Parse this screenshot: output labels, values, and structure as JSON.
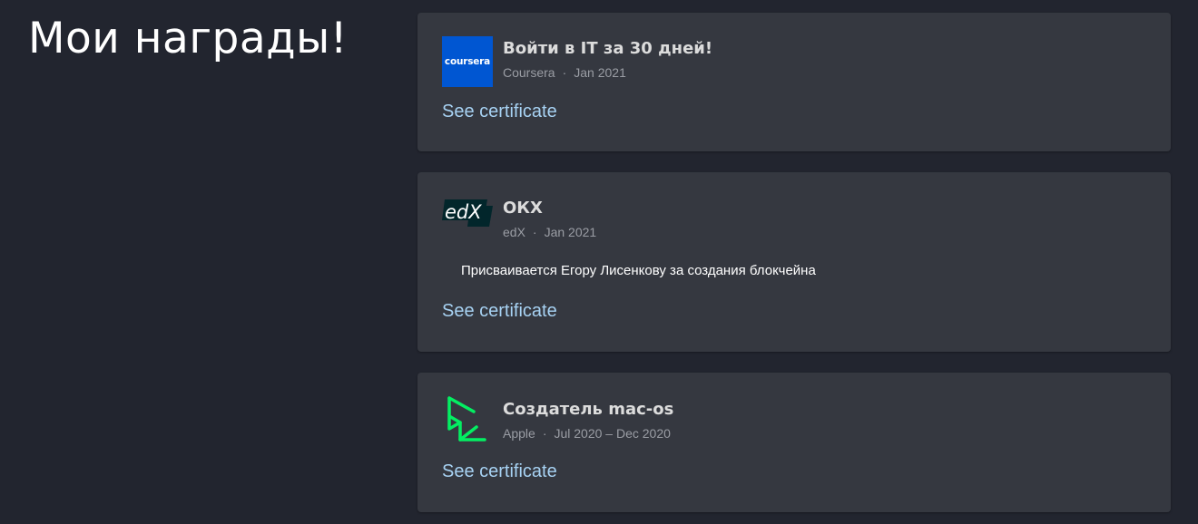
{
  "page": {
    "title": "Мои награды!"
  },
  "certificates": [
    {
      "title": "Войти в IT за 30 дней!",
      "issuer": "Coursera",
      "separator": "·",
      "date": "Jan 2021",
      "logo_text": "coursera",
      "logo_icon": "coursera-logo",
      "link_label": "See certificate"
    },
    {
      "title": "ОКХ",
      "issuer": "edX",
      "separator": "·",
      "date": "Jan 2021",
      "description": "Присваивается Егору Лисенкову за создания блокчейна",
      "logo_text": "edX",
      "logo_icon": "edx-logo",
      "link_label": "See certificate"
    },
    {
      "title": "Создатель mac-os",
      "issuer": "Apple",
      "separator": "·",
      "date": "Jul 2020 – Dec 2020",
      "logo_icon": "datacamp-logo",
      "link_label": "See certificate"
    }
  ],
  "colors": {
    "background": "#22252f",
    "card": "#353840",
    "link": "#a7d2f3",
    "coursera_blue": "#0056d2",
    "edx_dark": "#02262b",
    "datacamp_green": "#03ef62"
  }
}
